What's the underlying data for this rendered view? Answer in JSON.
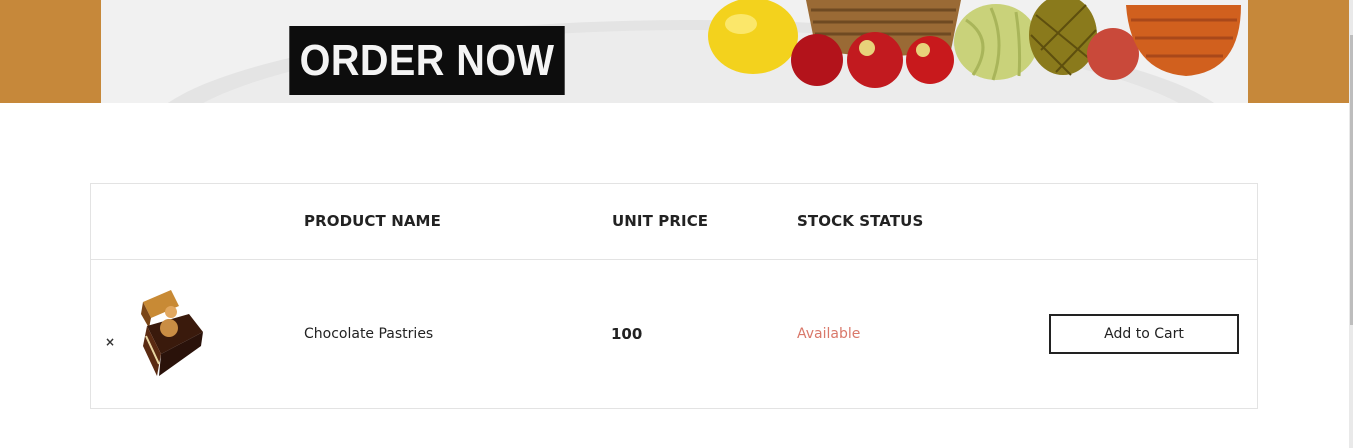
{
  "banner": {
    "cta_label": "ORDER NOW",
    "background_color": "#c6883a",
    "image": "fruit-basket-illustration"
  },
  "wishlist": {
    "columns": {
      "product_name": "PRODUCT NAME",
      "unit_price": "UNIT PRICE",
      "stock_status": "STOCK STATUS"
    },
    "rows": [
      {
        "remove_icon": "×",
        "image": "chocolate-pastry-thumbnail",
        "product_name": "Chocolate Pastries",
        "unit_price": "100",
        "stock_status": "Available",
        "stock_color": "#d9786a",
        "action_label": "Add to Cart"
      }
    ]
  }
}
